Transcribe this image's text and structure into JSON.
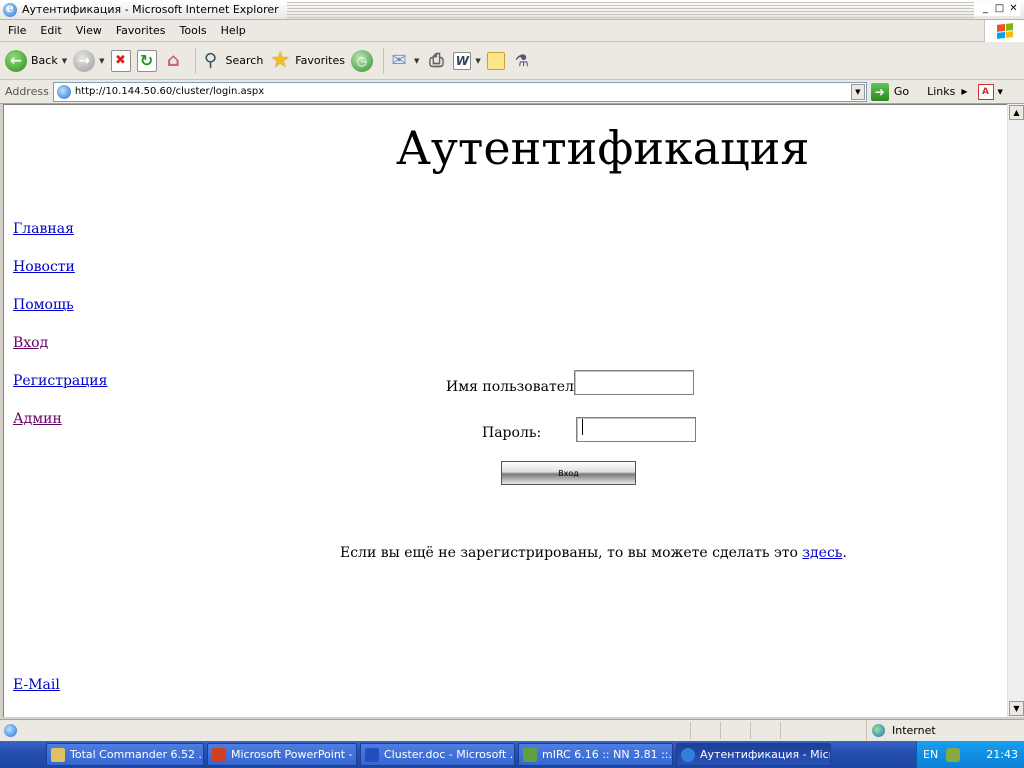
{
  "window": {
    "title": "Аутентификация - Microsoft Internet Explorer",
    "controls": {
      "minimize": "_",
      "maximize": "□",
      "close": "✕"
    }
  },
  "menu": [
    "File",
    "Edit",
    "View",
    "Favorites",
    "Tools",
    "Help"
  ],
  "toolbar": {
    "back_label": "Back",
    "search_label": "Search",
    "favorites_label": "Favorites"
  },
  "address": {
    "label": "Address",
    "url": "http://10.144.50.60/cluster/login.aspx",
    "go_label": "Go",
    "links_label": "Links"
  },
  "page": {
    "title": "Аутентификация",
    "nav": [
      {
        "label": "Главная",
        "visited": false
      },
      {
        "label": "Новости",
        "visited": false
      },
      {
        "label": "Помощь",
        "visited": false
      },
      {
        "label": "Вход",
        "visited": true
      },
      {
        "label": "Регистрация",
        "visited": false
      },
      {
        "label": "Админ",
        "visited": true
      }
    ],
    "form": {
      "username_label": "Имя пользователя:",
      "username_value": "",
      "password_label": "Пароль:",
      "password_value": "",
      "submit_label": "Вход"
    },
    "register": {
      "text_before": "Если вы ещё не зарегистрированы, то вы можете сделать это ",
      "link": "здесь",
      "text_after": "."
    },
    "email_link": "E-Mail"
  },
  "status": {
    "zone": "Internet"
  },
  "taskbar": {
    "tasks": [
      {
        "label": "Total Commander 6.52 ...",
        "color": "#e0c060"
      },
      {
        "label": "Microsoft PowerPoint - [...",
        "color": "#d04020"
      },
      {
        "label": "Cluster.doc - Microsoft ...",
        "color": "#2050c0"
      },
      {
        "label": "mIRC 6.16 :: NN 3.81 ::...",
        "color": "#60a040"
      },
      {
        "label": "Аутентификация - Micr...",
        "color": "#3080e0",
        "active": true
      }
    ],
    "language": "EN",
    "clock": "21:43"
  }
}
